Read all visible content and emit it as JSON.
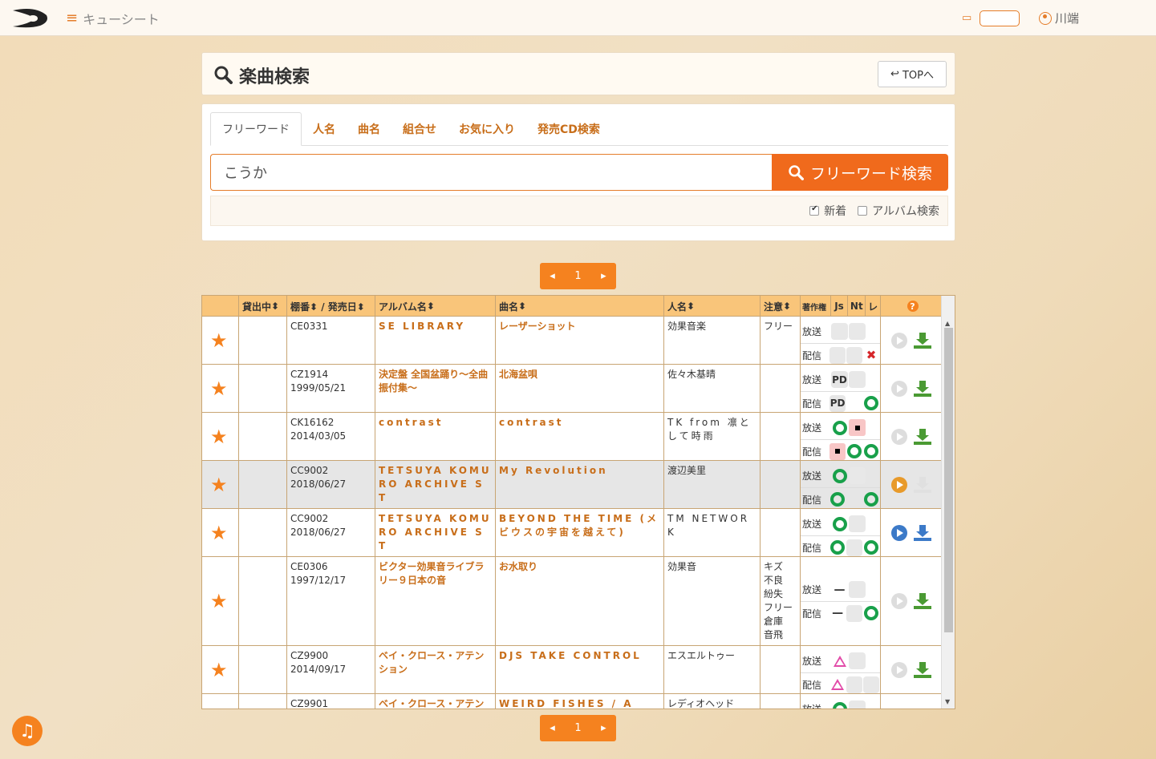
{
  "header": {
    "app_name": "キューシート",
    "user_name": "川端"
  },
  "title": {
    "text": "楽曲検索",
    "top_button": "TOPへ"
  },
  "tabs": [
    {
      "label": "フリーワード",
      "active": true
    },
    {
      "label": "人名"
    },
    {
      "label": "曲名"
    },
    {
      "label": "組合せ"
    },
    {
      "label": "お気に入り"
    },
    {
      "label": "発売CD検索"
    }
  ],
  "search": {
    "value": "こうか",
    "button": "フリーワード検索"
  },
  "options": [
    {
      "label": "新着",
      "checked": true
    },
    {
      "label": "アルバム検索",
      "checked": false
    }
  ],
  "pager": {
    "page": "1"
  },
  "table": {
    "headers": [
      "",
      "貸出中",
      "棚番 / 発売日",
      "アルバム名",
      "曲名",
      "人名",
      "注意",
      "著作権",
      "Js",
      "Nt",
      "レ"
    ],
    "rows": [
      {
        "shelf": "CE0331",
        "date": "",
        "album": "SE LIBRARY",
        "song": "レーザーショット",
        "person": "効果音楽",
        "note": "フリー"
      },
      {
        "shelf": "CZ1914",
        "date": "1999/05/21",
        "album": "決定盤 全国盆踊り〜全曲振付集〜",
        "song": "北海盆唄",
        "person": "佐々木基晴",
        "note": ""
      },
      {
        "shelf": "CK16162",
        "date": "2014/03/05",
        "album": "contrast",
        "song": "contrast",
        "person": "TK from 凛として時雨",
        "note": ""
      },
      {
        "shelf": "CC9002",
        "date": "2018/06/27",
        "album": "TETSUYA KOMURO ARCHIVE S T",
        "song": "My Revolution",
        "person": "渡辺美里",
        "note": ""
      },
      {
        "shelf": "CC9002",
        "date": "2018/06/27",
        "album": "TETSUYA KOMURO ARCHIVE S T",
        "song": "BEYOND THE TIME (メビウスの宇宙を越えて)",
        "person": "TM NETWORK",
        "note": ""
      },
      {
        "shelf": "CE0306",
        "date": "1997/12/17",
        "album": "ビクター効果音ライブラリー９日本の音",
        "song": "お水取り",
        "person": "効果音",
        "note": "キズ 不良 紛失 フリー 倉庫 音飛"
      },
      {
        "shelf": "CZ9900",
        "date": "2014/09/17",
        "album": "ベイ・クロース・アテンション",
        "song": "DJS TAKE CONTROL",
        "person": "エスエルトゥー",
        "note": ""
      },
      {
        "shelf": "CZ9901",
        "date": "",
        "album": "ベイ・クロース・アテン",
        "song": "WEIRD FISHES / A",
        "person": "レディオヘッド",
        "note": ""
      }
    ],
    "labels": {
      "broadcast": "放送",
      "distribution": "配信"
    }
  },
  "colors": {
    "accent": "#f5821f",
    "header_row": "#f9c57a",
    "ok_ring": "#18a04a"
  }
}
